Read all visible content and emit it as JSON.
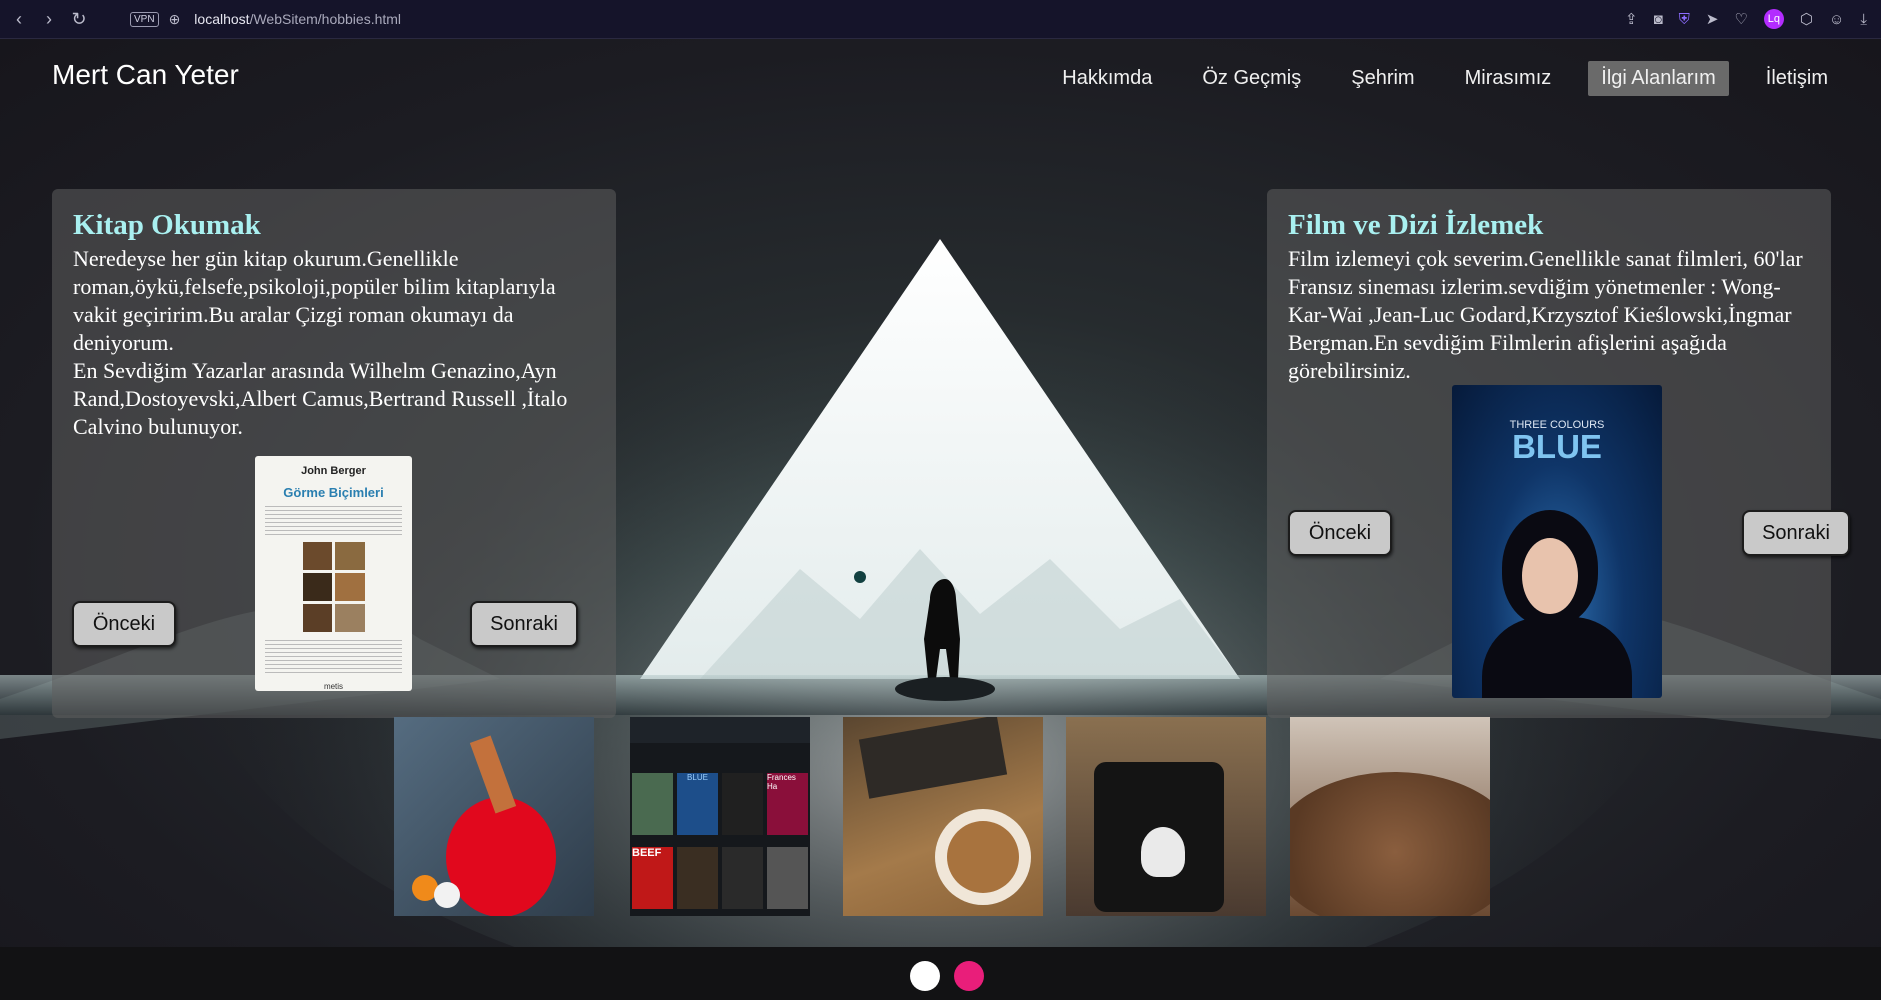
{
  "browser": {
    "url_host": "localhost",
    "url_path": "/WebSitem/hobbies.html",
    "vpn_label": "VPN",
    "profile_initial": "Lq"
  },
  "site": {
    "logo": "Mert Can Yeter",
    "nav": [
      {
        "label": "Hakkımda",
        "active": false
      },
      {
        "label": "Öz Geçmiş",
        "active": false
      },
      {
        "label": "Şehrim",
        "active": false
      },
      {
        "label": "Mirasımız",
        "active": false
      },
      {
        "label": "İlgi Alanlarım",
        "active": true
      },
      {
        "label": "İletişim",
        "active": false
      }
    ]
  },
  "cards": {
    "books": {
      "title": "Kitap Okumak",
      "text": "Neredeyse her gün kitap okurum.Genellikle roman,öykü,felsefe,psikoloji,popüler bilim kitaplarıyla vakit geçiririm.Bu aralar Çizgi roman okumayı da deniyorum.\nEn Sevdiğim Yazarlar arasında Wilhelm Genazino,Ayn Rand,Dostoyevski,Albert Camus,Bertrand Russell ,İtalo Calvino bulunuyor.",
      "prev_label": "Önceki",
      "next_label": "Sonraki",
      "cover": {
        "author": "John Berger",
        "title": "Görme Biçimleri",
        "publisher": "metis"
      }
    },
    "films": {
      "title": "Film ve Dizi İzlemek",
      "text": "Film izlemeyi çok severim.Genellikle sanat filmleri, 60'lar Fransız sineması izlerim.sevdiğim yönetmenler : Wong-Kar-Wai ,Jean-Luc Godard,Krzysztof Kieślowski,İngmar Bergman.En sevdiğim Filmlerin afişlerini aşağıda görebilirsiniz.",
      "prev_label": "Önceki",
      "next_label": "Sonraki",
      "poster": {
        "top": "THREE COLOURS",
        "title": "BLUE"
      }
    }
  },
  "gallery": {
    "items": [
      "table-tennis",
      "film-app",
      "coffee-books",
      "skull-mug",
      "coffee-grounds"
    ],
    "app_posters": [
      "",
      "BLUE",
      "",
      "Frances Ha",
      "BEEF",
      "",
      "",
      ""
    ]
  },
  "carousel": {
    "dots": [
      {
        "color": "#ffffff"
      },
      {
        "color": "#e91e7a"
      }
    ]
  }
}
